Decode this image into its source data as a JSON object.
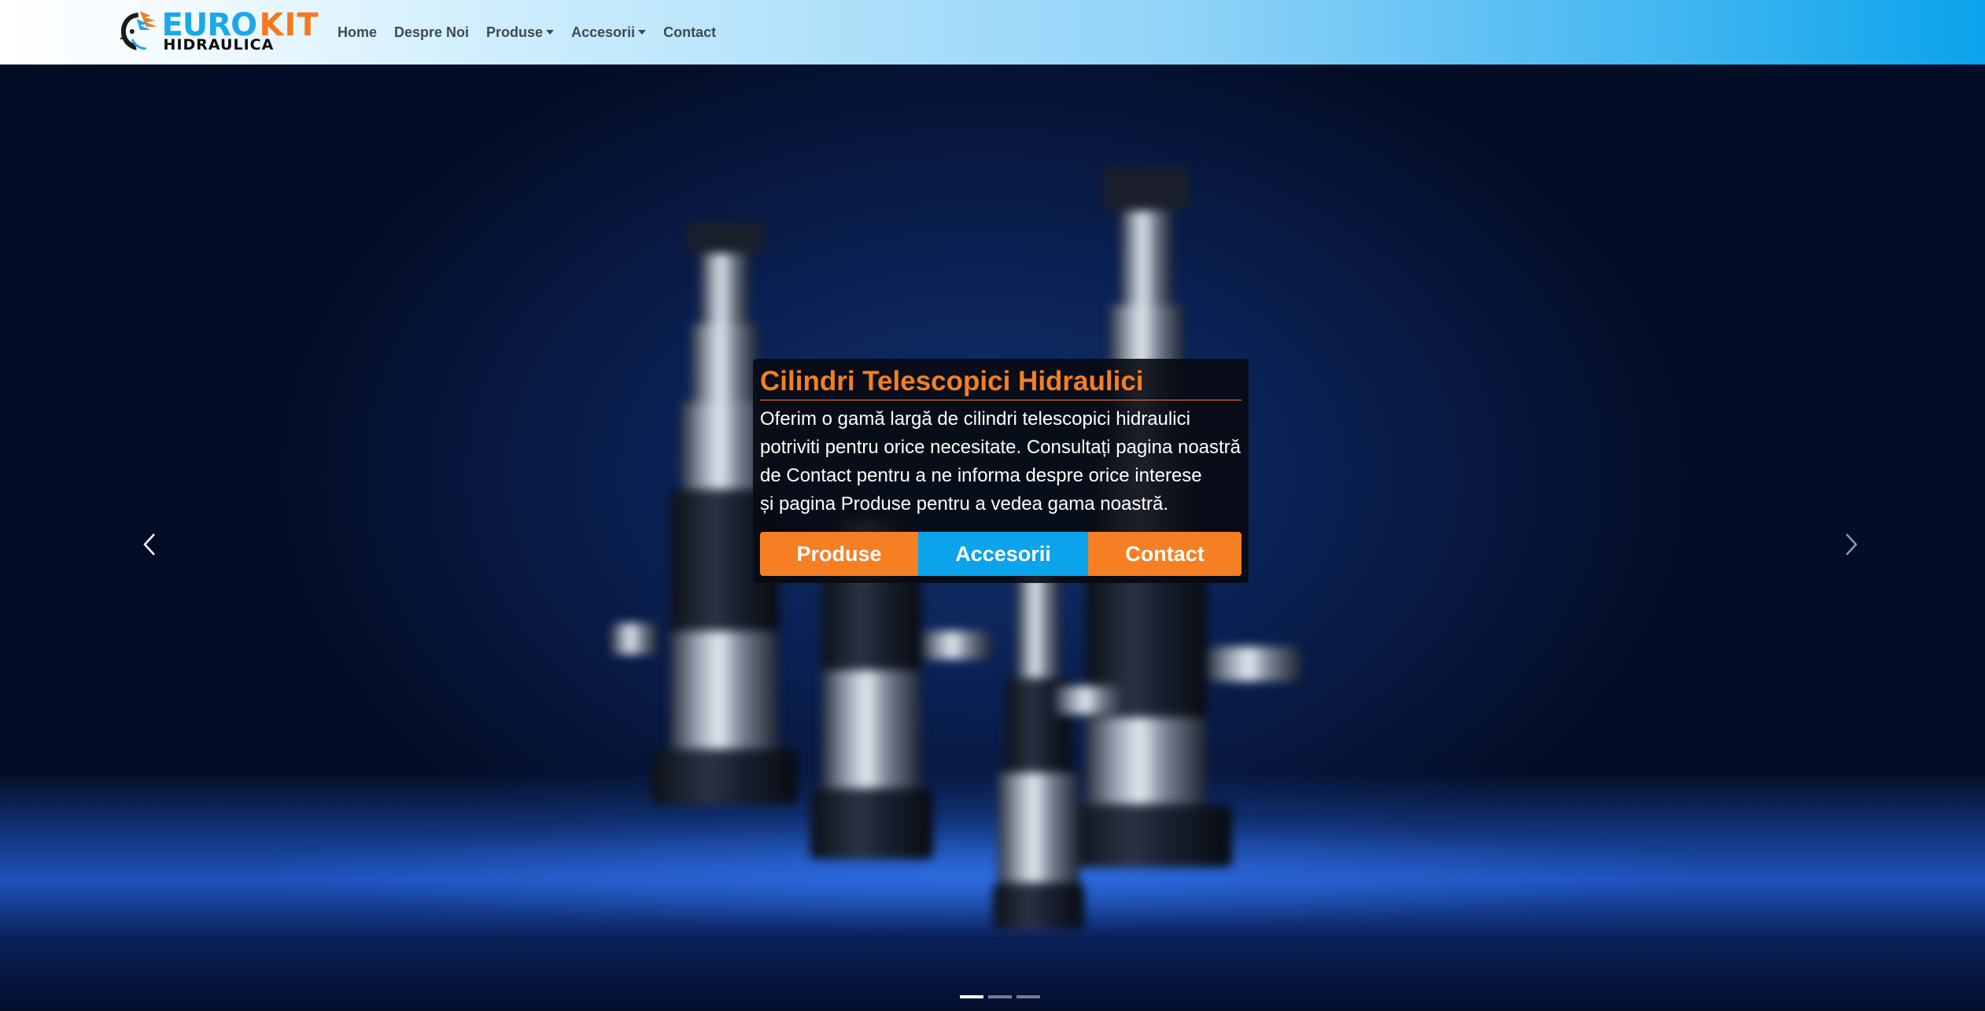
{
  "brand": {
    "name_primary": "EURO",
    "name_secondary": "KIT",
    "subtitle": "HIDRAULICA",
    "colors": {
      "blue": "#1ea7e8",
      "orange": "#f47a20"
    }
  },
  "nav": {
    "items": [
      {
        "label": "Home",
        "dropdown": false
      },
      {
        "label": "Despre Noi",
        "dropdown": false
      },
      {
        "label": "Produse",
        "dropdown": true
      },
      {
        "label": "Accesorii",
        "dropdown": true
      },
      {
        "label": "Contact",
        "dropdown": false
      }
    ]
  },
  "carousel": {
    "active_slide": 1,
    "slide_count": 3,
    "prev_icon": "chevron-left-icon",
    "next_icon": "chevron-right-icon",
    "caption": {
      "title": "Cilindri Telescopici Hidraulici",
      "lines": [
        "Oferim o gamă largă de cilindri telescopici hidraulici",
        "potriviti pentru orice necesitate. Consultați pagina noastră",
        "de Contact pentru a ne informa despre orice interese",
        "și pagina Produse pentru a vedea gama noastră."
      ],
      "buttons": [
        {
          "label": "Produse",
          "color": "#f57f22"
        },
        {
          "label": "Accesorii",
          "color": "#0aa3ec"
        },
        {
          "label": "Contact",
          "color": "#f57f22"
        }
      ]
    }
  }
}
